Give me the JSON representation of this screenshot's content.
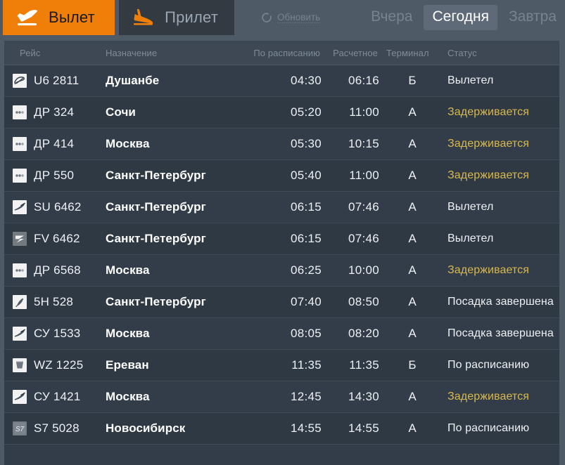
{
  "header": {
    "tabs": [
      {
        "id": "departure",
        "label": "Вылет",
        "icon": "plane-departure-icon",
        "active": true
      },
      {
        "id": "arrival",
        "label": "Прилет",
        "icon": "plane-arrival-icon",
        "active": false
      }
    ],
    "refresh": {
      "label": "Обновить",
      "icon": "refresh-icon"
    },
    "days": [
      {
        "id": "yesterday",
        "label": "Вчера",
        "active": false
      },
      {
        "id": "today",
        "label": "Сегодня",
        "active": true
      },
      {
        "id": "tomorrow",
        "label": "Завтра",
        "active": false
      }
    ]
  },
  "colors": {
    "accent": "#f07f09",
    "page_bg": "#4e5a66",
    "table_bg": "#333d49",
    "row_alt_bg": "#2f3944",
    "header_row_bg": "#3d4854",
    "text": "#eef1f4",
    "muted": "#808b97",
    "delayed": "#d9b84c",
    "active_day_bg": "#5e6a77"
  },
  "table": {
    "columns": [
      {
        "key": "flight",
        "label": "Рейс"
      },
      {
        "key": "destination",
        "label": "Назначение"
      },
      {
        "key": "scheduled",
        "label": "По расписанию"
      },
      {
        "key": "estimated",
        "label": "Расчетное"
      },
      {
        "key": "terminal",
        "label": "Терминал"
      },
      {
        "key": "status",
        "label": "Статус"
      }
    ],
    "rows": [
      {
        "logo": "airline-logo-u6",
        "flight": "U6 2811",
        "destination": "Душанбе",
        "scheduled": "04:30",
        "estimated": "06:16",
        "terminal": "Б",
        "status": "Вылетел",
        "delayed": false
      },
      {
        "logo": "airline-logo-dr",
        "flight": "ДР 324",
        "destination": "Сочи",
        "scheduled": "05:20",
        "estimated": "11:00",
        "terminal": "А",
        "status": "Задерживается",
        "delayed": true
      },
      {
        "logo": "airline-logo-dr",
        "flight": "ДР 414",
        "destination": "Москва",
        "scheduled": "05:30",
        "estimated": "10:15",
        "terminal": "А",
        "status": "Задерживается",
        "delayed": true
      },
      {
        "logo": "airline-logo-dr",
        "flight": "ДР 550",
        "destination": "Санкт-Петербург",
        "scheduled": "05:40",
        "estimated": "11:00",
        "terminal": "А",
        "status": "Задерживается",
        "delayed": true
      },
      {
        "logo": "airline-logo-su",
        "flight": "SU 6462",
        "destination": "Санкт-Петербург",
        "scheduled": "06:15",
        "estimated": "07:46",
        "terminal": "А",
        "status": "Вылетел",
        "delayed": false
      },
      {
        "logo": "airline-logo-fv",
        "flight": "FV 6462",
        "destination": "Санкт-Петербург",
        "scheduled": "06:15",
        "estimated": "07:46",
        "terminal": "А",
        "status": "Вылетел",
        "delayed": false
      },
      {
        "logo": "airline-logo-dr",
        "flight": "ДР 6568",
        "destination": "Москва",
        "scheduled": "06:25",
        "estimated": "10:00",
        "terminal": "А",
        "status": "Задерживается",
        "delayed": true
      },
      {
        "logo": "airline-logo-5h",
        "flight": "5H 528",
        "destination": "Санкт-Петербург",
        "scheduled": "07:40",
        "estimated": "08:50",
        "terminal": "А",
        "status": "Посадка завершена",
        "delayed": false
      },
      {
        "logo": "airline-logo-su",
        "flight": "СУ 1533",
        "destination": "Москва",
        "scheduled": "08:05",
        "estimated": "08:20",
        "terminal": "А",
        "status": "Посадка завершена",
        "delayed": false
      },
      {
        "logo": "airline-logo-wz",
        "flight": "WZ 1225",
        "destination": "Ереван",
        "scheduled": "11:35",
        "estimated": "11:35",
        "terminal": "Б",
        "status": "По расписанию",
        "delayed": false
      },
      {
        "logo": "airline-logo-su",
        "flight": "СУ 1421",
        "destination": "Москва",
        "scheduled": "12:45",
        "estimated": "14:30",
        "terminal": "А",
        "status": "Задерживается",
        "delayed": true
      },
      {
        "logo": "airline-logo-s7",
        "flight": "S7 5028",
        "destination": "Новосибирск",
        "scheduled": "14:55",
        "estimated": "14:55",
        "terminal": "А",
        "status": "По расписанию",
        "delayed": false
      }
    ]
  }
}
